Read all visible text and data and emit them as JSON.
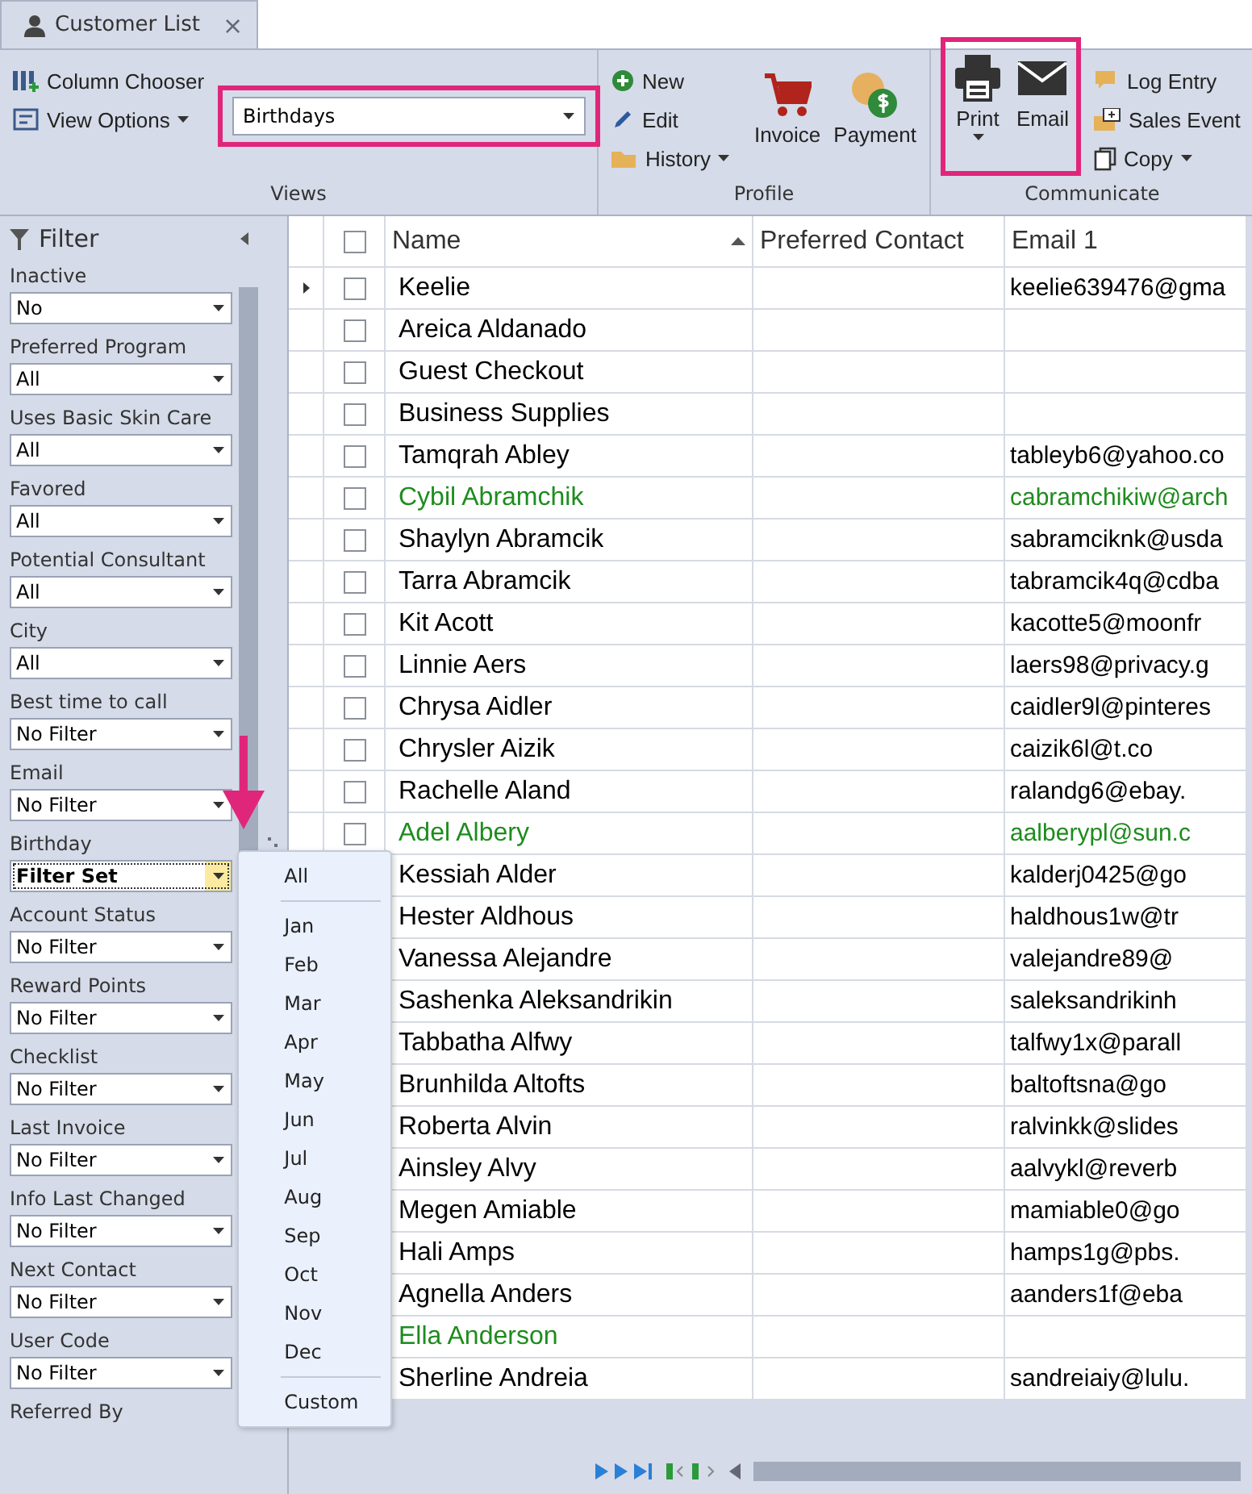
{
  "tab": {
    "title": "Customer List",
    "close": "×",
    "selected": true
  },
  "ribbon": {
    "groups": [
      {
        "label": "Views",
        "small": [
          {
            "label": "Column Chooser",
            "dropdown": false
          },
          {
            "label": "View Options",
            "dropdown": true
          }
        ],
        "view_select": {
          "value": "Birthdays",
          "highlighted": true
        }
      },
      {
        "label": "Profile",
        "kind": "small-first",
        "small": [
          {
            "label": "New",
            "dropdown": false
          },
          {
            "label": "Edit",
            "dropdown": false
          },
          {
            "label": "History",
            "dropdown": true
          }
        ],
        "large": [
          {
            "label": "Invoice",
            "dropdown": false
          },
          {
            "label": "Payment",
            "dropdown": false
          }
        ]
      },
      {
        "label": "Communicate",
        "kind": "large-first",
        "large_highlighted": true,
        "large": [
          {
            "label": "Print",
            "dropdown": true
          },
          {
            "label": "Email",
            "dropdown": false
          }
        ],
        "small": [
          {
            "label": "Log Entry",
            "dropdown": false
          },
          {
            "label": "Sales Event",
            "dropdown": false
          },
          {
            "label": "Copy",
            "dropdown": true
          }
        ]
      }
    ]
  },
  "filter": {
    "title": "Filter",
    "fields": [
      {
        "label": "Inactive",
        "value": "No",
        "filter_set": false,
        "open": false
      },
      {
        "label": "Preferred Program",
        "value": "All",
        "filter_set": false,
        "open": false
      },
      {
        "label": "Uses Basic Skin Care",
        "value": "All",
        "filter_set": false,
        "open": false
      },
      {
        "label": "Favored",
        "value": "All",
        "filter_set": false,
        "open": false
      },
      {
        "label": "Potential Consultant",
        "value": "All",
        "filter_set": false,
        "open": false
      },
      {
        "label": "City",
        "value": "All",
        "filter_set": false,
        "open": false
      },
      {
        "label": "Best time to call",
        "value": "No Filter",
        "filter_set": false,
        "open": false
      },
      {
        "label": "Email",
        "value": "No Filter",
        "filter_set": false,
        "open": false
      },
      {
        "label": "Birthday",
        "value": "Filter Set",
        "filter_set": true,
        "open": true,
        "menu_groups": [
          [
            "All"
          ],
          [
            "Jan",
            "Feb",
            "Mar",
            "Apr",
            "May",
            "Jun",
            "Jul",
            "Aug",
            "Sep",
            "Oct",
            "Nov",
            "Dec"
          ],
          [
            "Custom"
          ]
        ]
      },
      {
        "label": "Account Status",
        "value": "No Filter",
        "filter_set": false,
        "open": false
      },
      {
        "label": "Reward Points",
        "value": "No Filter",
        "filter_set": false,
        "open": false
      },
      {
        "label": "Checklist",
        "value": "No Filter",
        "filter_set": false,
        "open": false
      },
      {
        "label": "Last Invoice",
        "value": "No Filter",
        "filter_set": false,
        "open": false
      },
      {
        "label": "Info Last Changed",
        "value": "No Filter",
        "filter_set": false,
        "open": false
      },
      {
        "label": "Next Contact",
        "value": "No Filter",
        "filter_set": false,
        "open": false
      },
      {
        "label": "User Code",
        "value": "No Filter",
        "filter_set": false,
        "open": false
      },
      {
        "label": "Referred By"
      }
    ]
  },
  "grid": {
    "columns": [
      {
        "label": "Name",
        "sorted": true
      },
      {
        "label": "Preferred Contact",
        "sorted": false
      },
      {
        "label": "Email 1",
        "sorted": false
      }
    ],
    "header_checked": false,
    "rows": [
      {
        "name": "Keelie",
        "email": "keelie639476@gma",
        "color": "#000000",
        "current": true,
        "checked": false
      },
      {
        "name": "Areica  Aldanado",
        "color": "#000000",
        "current": false,
        "checked": false
      },
      {
        "name": "Guest  Checkout",
        "color": "#000000",
        "current": false,
        "checked": false
      },
      {
        "name": "Business  Supplies",
        "color": "#000000",
        "current": false,
        "checked": false
      },
      {
        "name": "Tamqrah Abley",
        "email": "tableyb6@yahoo.co",
        "color": "#000000",
        "current": false,
        "checked": false
      },
      {
        "name": "Cybil Abramchik",
        "email": "cabramchikiw@arch",
        "color": "#1e8c1e",
        "current": false,
        "checked": false
      },
      {
        "name": "Shaylyn Abramcik",
        "email": "sabramciknk@usda",
        "color": "#000000",
        "current": false,
        "checked": false
      },
      {
        "name": "Tarra Abramcik",
        "email": "tabramcik4q@cdba",
        "color": "#000000",
        "current": false,
        "checked": false
      },
      {
        "name": "Kit Acott",
        "email": "kacotte5@moonfr",
        "color": "#000000",
        "current": false,
        "checked": false
      },
      {
        "name": "Linnie Aers",
        "email": "laers98@privacy.g",
        "color": "#000000",
        "current": false,
        "checked": false
      },
      {
        "name": "Chrysa Aidler",
        "email": "caidler9l@pinteres",
        "color": "#000000",
        "current": false,
        "checked": false
      },
      {
        "name": "Chrysler Aizik",
        "email": "caizik6l@t.co",
        "color": "#000000",
        "current": false,
        "checked": false
      },
      {
        "name": "Rachelle Aland",
        "email": "ralandg6@ebay.",
        "color": "#000000",
        "current": false,
        "checked": false
      },
      {
        "name": "Adel Albery",
        "email": "aalberypl@sun.c",
        "color": "#1e8c1e",
        "current": false,
        "checked": false
      },
      {
        "name": "Kessiah Alder",
        "email": "kalderj0425@go",
        "color": "#000000"
      },
      {
        "name": "Hester Aldhous",
        "email": "haldhous1w@tr",
        "color": "#000000"
      },
      {
        "name": "Vanessa Alejandre",
        "email": "valejandre89@",
        "color": "#000000"
      },
      {
        "name": "Sashenka Aleksandrikin",
        "email": "saleksandrikinh",
        "color": "#000000"
      },
      {
        "name": "Tabbatha Alfwy",
        "email": "talfwy1x@parall",
        "color": "#000000"
      },
      {
        "name": "Brunhilda Altofts",
        "email": "baltoftsna@go",
        "color": "#000000"
      },
      {
        "name": "Roberta Alvin",
        "email": "ralvinkk@slides",
        "color": "#000000"
      },
      {
        "name": "Ainsley Alvy",
        "email": "aalvykl@reverb",
        "color": "#000000"
      },
      {
        "name": "Megen Amiable",
        "email": "mamiable0@go",
        "color": "#000000"
      },
      {
        "name": "Hali Amps",
        "email": "hamps1g@pbs.",
        "color": "#000000"
      },
      {
        "name": "Agnella Anders",
        "email": "aanders1f@eba",
        "color": "#000000"
      },
      {
        "name": "Ella Anderson",
        "color": "#1e8c1e"
      },
      {
        "name": "Sherline Andreia",
        "email": "sandreiaiy@lulu.",
        "color": "#000000"
      }
    ]
  }
}
